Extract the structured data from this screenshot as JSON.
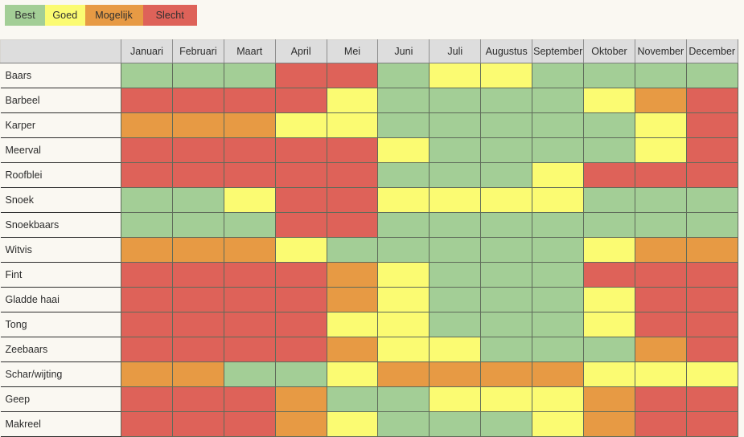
{
  "legend": {
    "items": [
      {
        "label": "Best",
        "color": "#a3ce96",
        "key": "green"
      },
      {
        "label": "Goed",
        "color": "#fbfb72",
        "key": "yellow"
      },
      {
        "label": "Mogelijk",
        "color": "#e79a44",
        "key": "orange"
      },
      {
        "label": "Slecht",
        "color": "#de6259",
        "key": "red"
      }
    ]
  },
  "table": {
    "corner_label": "",
    "columns": [
      "Januari",
      "Februari",
      "Maart",
      "April",
      "Mei",
      "Juni",
      "Juli",
      "Augustus",
      "September",
      "Oktober",
      "November",
      "December"
    ],
    "rows": [
      {
        "label": "Baars",
        "values": [
          "green",
          "green",
          "green",
          "red",
          "red",
          "green",
          "yellow",
          "yellow",
          "green",
          "green",
          "green",
          "green"
        ]
      },
      {
        "label": "Barbeel",
        "values": [
          "red",
          "red",
          "red",
          "red",
          "yellow",
          "green",
          "green",
          "green",
          "green",
          "yellow",
          "orange",
          "red"
        ]
      },
      {
        "label": "Karper",
        "values": [
          "orange",
          "orange",
          "orange",
          "yellow",
          "yellow",
          "green",
          "green",
          "green",
          "green",
          "green",
          "yellow",
          "red"
        ]
      },
      {
        "label": "Meerval",
        "values": [
          "red",
          "red",
          "red",
          "red",
          "red",
          "yellow",
          "green",
          "green",
          "green",
          "green",
          "yellow",
          "red"
        ]
      },
      {
        "label": "Roofblei",
        "values": [
          "red",
          "red",
          "red",
          "red",
          "red",
          "green",
          "green",
          "green",
          "yellow",
          "red",
          "red",
          "red"
        ]
      },
      {
        "label": "Snoek",
        "values": [
          "green",
          "green",
          "yellow",
          "red",
          "red",
          "yellow",
          "yellow",
          "yellow",
          "yellow",
          "green",
          "green",
          "green"
        ]
      },
      {
        "label": "Snoekbaars",
        "values": [
          "green",
          "green",
          "green",
          "red",
          "red",
          "green",
          "green",
          "green",
          "green",
          "green",
          "green",
          "green"
        ]
      },
      {
        "label": "Witvis",
        "values": [
          "orange",
          "orange",
          "orange",
          "yellow",
          "green",
          "green",
          "green",
          "green",
          "green",
          "yellow",
          "orange",
          "orange"
        ]
      },
      {
        "label": "Fint",
        "values": [
          "red",
          "red",
          "red",
          "red",
          "orange",
          "yellow",
          "green",
          "green",
          "green",
          "red",
          "red",
          "red"
        ]
      },
      {
        "label": "Gladde haai",
        "values": [
          "red",
          "red",
          "red",
          "red",
          "orange",
          "yellow",
          "green",
          "green",
          "green",
          "yellow",
          "red",
          "red"
        ]
      },
      {
        "label": "Tong",
        "values": [
          "red",
          "red",
          "red",
          "red",
          "yellow",
          "yellow",
          "green",
          "green",
          "green",
          "yellow",
          "red",
          "red"
        ]
      },
      {
        "label": "Zeebaars",
        "values": [
          "red",
          "red",
          "red",
          "red",
          "orange",
          "yellow",
          "yellow",
          "green",
          "green",
          "green",
          "orange",
          "red"
        ]
      },
      {
        "label": "Schar/wijting",
        "values": [
          "orange",
          "orange",
          "green",
          "green",
          "yellow",
          "orange",
          "orange",
          "orange",
          "orange",
          "yellow",
          "yellow",
          "yellow"
        ]
      },
      {
        "label": "Geep",
        "values": [
          "red",
          "red",
          "red",
          "orange",
          "green",
          "green",
          "yellow",
          "yellow",
          "yellow",
          "orange",
          "red",
          "red"
        ]
      },
      {
        "label": "Makreel",
        "values": [
          "red",
          "red",
          "red",
          "orange",
          "yellow",
          "green",
          "green",
          "green",
          "yellow",
          "orange",
          "red",
          "red"
        ]
      }
    ]
  },
  "colors": {
    "green": "#a3ce96",
    "yellow": "#fbfb72",
    "orange": "#e79a44",
    "red": "#de6259",
    "page_background": "#faf8f2",
    "header_background": "#dddddd",
    "cell_border": "#5f6b5a",
    "row_separator": "#2e2e2e"
  }
}
